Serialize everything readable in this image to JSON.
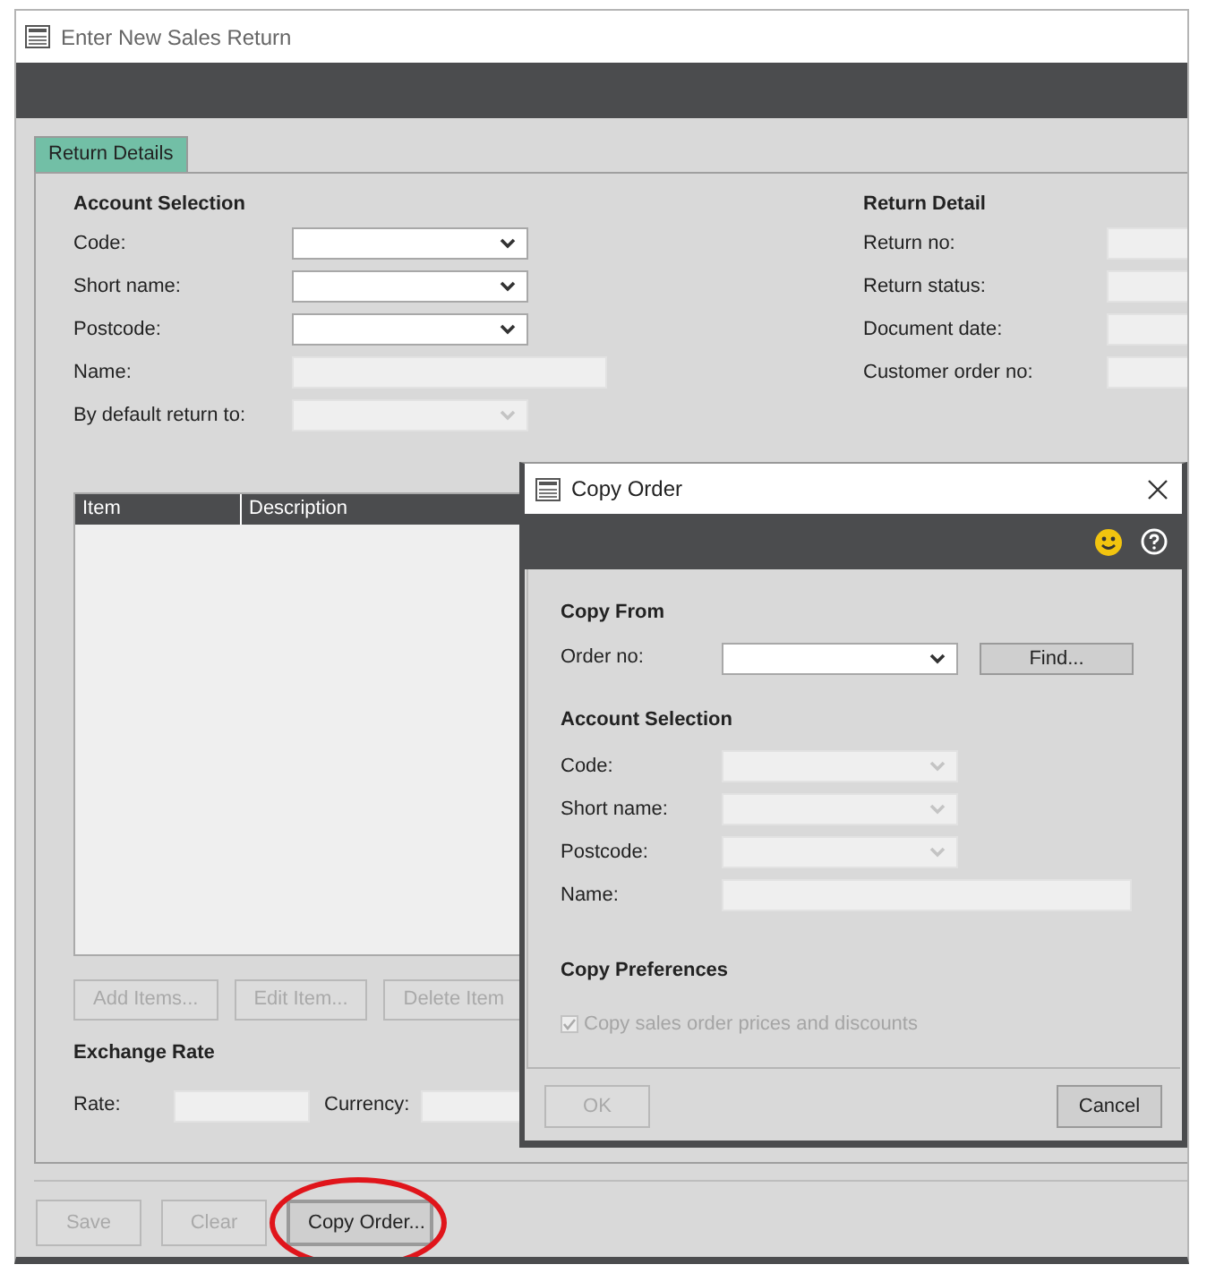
{
  "window": {
    "title": "Enter New Sales Return"
  },
  "tabs": [
    {
      "label": "Return Details",
      "selected": true
    }
  ],
  "account_selection": {
    "heading": "Account Selection",
    "fields": [
      {
        "label": "Code:",
        "kind": "dropdown",
        "disabled": false
      },
      {
        "label": "Short name:",
        "kind": "dropdown",
        "disabled": false
      },
      {
        "label": "Postcode:",
        "kind": "dropdown",
        "disabled": false
      },
      {
        "label": "Name:",
        "kind": "text",
        "disabled": true
      },
      {
        "label": "By default return to:",
        "kind": "dropdown",
        "disabled": true
      }
    ]
  },
  "return_detail": {
    "heading": "Return Detail",
    "fields": [
      {
        "label": "Return no:"
      },
      {
        "label": "Return status:"
      },
      {
        "label": "Document date:"
      },
      {
        "label": "Customer order no:"
      }
    ]
  },
  "table": {
    "columns": [
      "Item",
      "Description"
    ]
  },
  "item_buttons": [
    {
      "label": "Add Items...",
      "disabled": true
    },
    {
      "label": "Edit Item...",
      "disabled": true
    },
    {
      "label": "Delete Item",
      "disabled": true
    }
  ],
  "exchange_rate": {
    "heading": "Exchange Rate",
    "rate_label": "Rate:",
    "currency_label": "Currency:"
  },
  "footer_buttons": [
    {
      "label": "Save",
      "disabled": true,
      "highlighted": false
    },
    {
      "label": "Clear",
      "disabled": true,
      "highlighted": false
    },
    {
      "label": "Copy Order...",
      "disabled": false,
      "highlighted": true
    }
  ],
  "dialog": {
    "title": "Copy Order",
    "copy_from": {
      "heading": "Copy From",
      "order_label": "Order no:",
      "find_button": "Find..."
    },
    "account_selection": {
      "heading": "Account Selection",
      "fields": [
        {
          "label": "Code:",
          "kind": "dropdown",
          "disabled": true
        },
        {
          "label": "Short name:",
          "kind": "dropdown",
          "disabled": true
        },
        {
          "label": "Postcode:",
          "kind": "dropdown",
          "disabled": true
        },
        {
          "label": "Name:",
          "kind": "text",
          "disabled": true
        }
      ]
    },
    "copy_preferences": {
      "heading": "Copy Preferences",
      "checkbox": {
        "label": "Copy sales order prices and discounts",
        "checked": true,
        "disabled": true
      }
    },
    "buttons": [
      {
        "label": "OK",
        "disabled": true
      },
      {
        "label": "Cancel",
        "disabled": false
      }
    ]
  }
}
